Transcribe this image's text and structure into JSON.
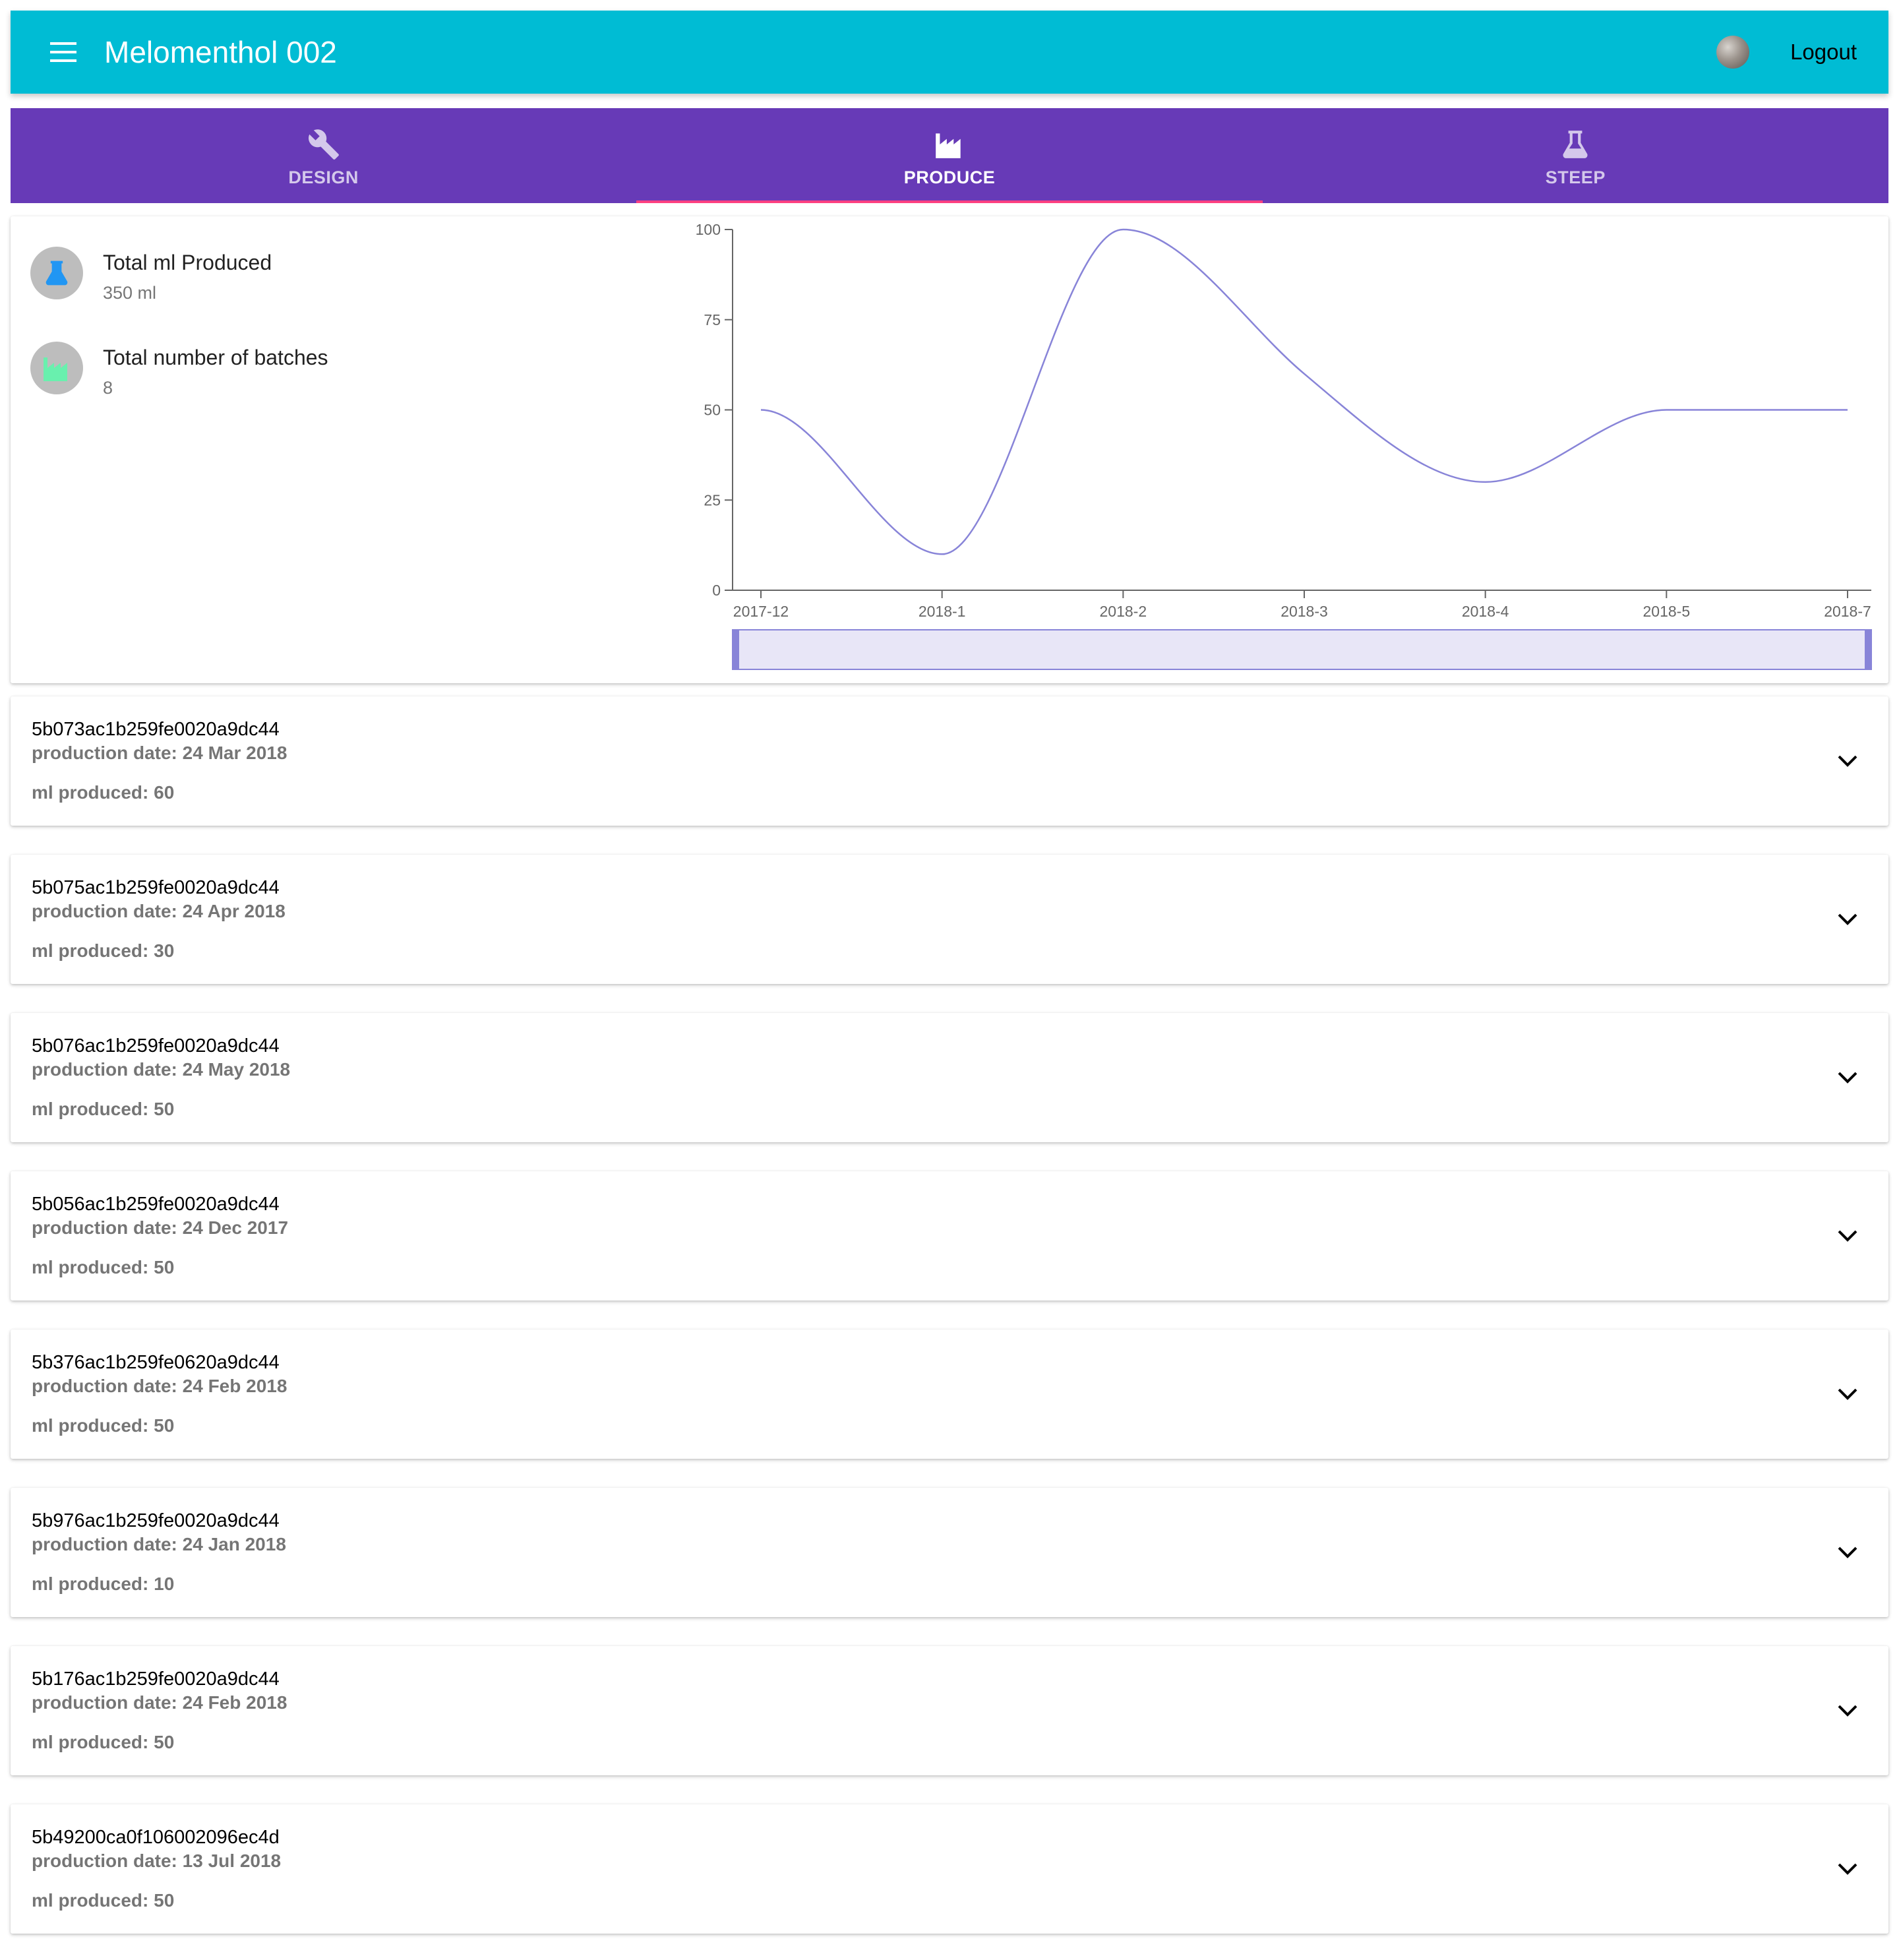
{
  "appbar": {
    "title": "Melomenthol 002",
    "menu_icon": "menu-icon",
    "logout_label": "Logout",
    "background": "#00bcd4"
  },
  "tabs": [
    {
      "label": "DESIGN",
      "icon": "wrench-icon",
      "active": false
    },
    {
      "label": "PRODUCE",
      "icon": "factory-icon",
      "active": true
    },
    {
      "label": "STEEP",
      "icon": "flask-icon",
      "active": false
    }
  ],
  "tab_colors": {
    "background": "#673ab7",
    "indicator": "#ff4081"
  },
  "summary": {
    "total_ml_title": "Total ml Produced",
    "total_ml_value": "350 ml",
    "total_batches_title": "Total number of batches",
    "total_batches_value": "8"
  },
  "chart_data": {
    "type": "line",
    "x": [
      "2017-12",
      "2018-1",
      "2018-2",
      "2018-3",
      "2018-4",
      "2018-5",
      "2018-7"
    ],
    "y_ticks": [
      "0",
      "25",
      "50",
      "75",
      "100"
    ],
    "series": [
      {
        "values": [
          50,
          10,
          100,
          60,
          30,
          50,
          50
        ],
        "color": "#8884d8"
      }
    ],
    "ylim": [
      0,
      100
    ],
    "brush": true
  },
  "batches": [
    {
      "id": "5b073ac1b259fe0020a9dc44",
      "date_label": "production date:",
      "date": "24 Mar 2018",
      "ml_label": "ml produced:",
      "ml": "60"
    },
    {
      "id": "5b075ac1b259fe0020a9dc44",
      "date_label": "production date:",
      "date": "24 Apr 2018",
      "ml_label": "ml produced:",
      "ml": "30"
    },
    {
      "id": "5b076ac1b259fe0020a9dc44",
      "date_label": "production date:",
      "date": "24 May 2018",
      "ml_label": "ml produced:",
      "ml": "50"
    },
    {
      "id": "5b056ac1b259fe0020a9dc44",
      "date_label": "production date:",
      "date": "24 Dec 2017",
      "ml_label": "ml produced:",
      "ml": "50"
    },
    {
      "id": "5b376ac1b259fe0620a9dc44",
      "date_label": "production date:",
      "date": "24 Feb 2018",
      "ml_label": "ml produced:",
      "ml": "50"
    },
    {
      "id": "5b976ac1b259fe0020a9dc44",
      "date_label": "production date:",
      "date": "24 Jan 2018",
      "ml_label": "ml produced:",
      "ml": "10"
    },
    {
      "id": "5b176ac1b259fe0020a9dc44",
      "date_label": "production date:",
      "date": "24 Feb 2018",
      "ml_label": "ml produced:",
      "ml": "50"
    },
    {
      "id": "5b49200ca0f106002096ec4d",
      "date_label": "production date:",
      "date": "13 Jul 2018",
      "ml_label": "ml produced:",
      "ml": "50"
    }
  ]
}
